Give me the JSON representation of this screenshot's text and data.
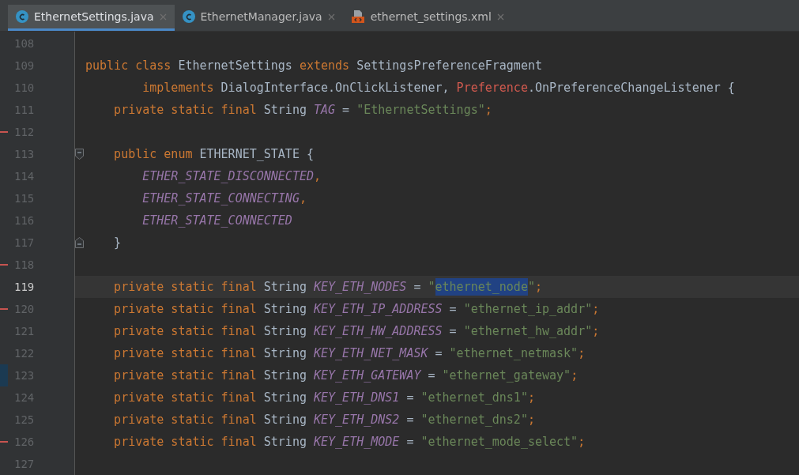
{
  "tabs": [
    {
      "label": "EthernetSettings.java",
      "kind": "class",
      "selected": true
    },
    {
      "label": "EthernetManager.java",
      "kind": "class",
      "selected": false
    },
    {
      "label": "ethernet_settings.xml",
      "kind": "xml",
      "selected": false
    }
  ],
  "lines": [
    {
      "number": "108",
      "kind": "code",
      "current": false
    },
    {
      "number": "109",
      "kind": "code",
      "current": false,
      "tokens": [
        {
          "kind": "kw",
          "text": "public class "
        },
        {
          "kind": "plain",
          "text": "EthernetSettings "
        },
        {
          "kind": "kw",
          "text": "extends "
        },
        {
          "kind": "plain",
          "text": "SettingsPreferenceFragment"
        }
      ]
    },
    {
      "number": "110",
      "kind": "code",
      "current": false,
      "tokens": [
        {
          "kind": "kw",
          "text": "        implements "
        },
        {
          "kind": "plain",
          "text": "DialogInterface.OnClickListener, "
        },
        {
          "kind": "error",
          "text": "Preference"
        },
        {
          "kind": "plain",
          "text": ".OnPreferenceChangeListener {"
        }
      ]
    },
    {
      "number": "111",
      "kind": "code",
      "current": false,
      "tokens": [
        {
          "kind": "kw",
          "text": "    private static final "
        },
        {
          "kind": "plain",
          "text": "String "
        },
        {
          "kind": "field",
          "text": "TAG"
        },
        {
          "kind": "plain",
          "text": " = "
        },
        {
          "kind": "str",
          "text": "\"EthernetSettings\""
        },
        {
          "kind": "kw",
          "text": ";"
        }
      ]
    },
    {
      "number": "112",
      "kind": "code",
      "current": false,
      "color": "#c75450"
    },
    {
      "number": "113",
      "kind": "fold_start",
      "current": false,
      "tokens": [
        {
          "kind": "kw",
          "text": "    public enum "
        },
        {
          "kind": "plain",
          "text": "ETHERNET_STATE {"
        }
      ]
    },
    {
      "number": "114",
      "kind": "code",
      "current": false,
      "tokens": [
        {
          "kind": "field",
          "text": "        ETHER_STATE_DISCONNECTED"
        },
        {
          "kind": "kw",
          "text": ","
        }
      ]
    },
    {
      "number": "115",
      "kind": "code",
      "current": false,
      "tokens": [
        {
          "kind": "field",
          "text": "        ETHER_STATE_CONNECTING"
        },
        {
          "kind": "kw",
          "text": ","
        }
      ]
    },
    {
      "number": "116",
      "kind": "code",
      "current": false,
      "tokens": [
        {
          "kind": "field",
          "text": "        ETHER_STATE_CONNECTED"
        }
      ]
    },
    {
      "number": "117",
      "kind": "fold_end",
      "current": false,
      "tokens": [
        {
          "kind": "plain",
          "text": "    }"
        }
      ]
    },
    {
      "number": "118",
      "kind": "code",
      "current": false,
      "color": "#c75450"
    },
    {
      "number": "119",
      "kind": "code",
      "current": true,
      "tokens": [
        {
          "kind": "kw",
          "text": "    private static final "
        },
        {
          "kind": "plain",
          "text": "String "
        },
        {
          "kind": "field",
          "text": "KEY_ETH_NODES"
        },
        {
          "kind": "plain",
          "text": " = "
        },
        {
          "kind": "str",
          "text": "\""
        },
        {
          "kind": "selection",
          "text": "ethernet_node"
        },
        {
          "kind": "str",
          "text": "\""
        },
        {
          "kind": "kw",
          "text": ";"
        }
      ]
    },
    {
      "number": "120",
      "kind": "code",
      "current": false,
      "color": "#c75450",
      "tokens": [
        {
          "kind": "kw",
          "text": "    private static final "
        },
        {
          "kind": "plain",
          "text": "String "
        },
        {
          "kind": "field",
          "text": "KEY_ETH_IP_ADDRESS"
        },
        {
          "kind": "plain",
          "text": " = "
        },
        {
          "kind": "str",
          "text": "\"ethernet_ip_addr\""
        },
        {
          "kind": "kw",
          "text": ";"
        }
      ]
    },
    {
      "number": "121",
      "kind": "code",
      "current": false,
      "tokens": [
        {
          "kind": "kw",
          "text": "    private static final "
        },
        {
          "kind": "plain",
          "text": "String "
        },
        {
          "kind": "field",
          "text": "KEY_ETH_HW_ADDRESS"
        },
        {
          "kind": "plain",
          "text": " = "
        },
        {
          "kind": "str",
          "text": "\"ethernet_hw_addr\""
        },
        {
          "kind": "kw",
          "text": ";"
        }
      ]
    },
    {
      "number": "122",
      "kind": "code",
      "current": false,
      "tokens": [
        {
          "kind": "kw",
          "text": "    private static final "
        },
        {
          "kind": "plain",
          "text": "String "
        },
        {
          "kind": "field",
          "text": "KEY_ETH_NET_MASK"
        },
        {
          "kind": "plain",
          "text": " = "
        },
        {
          "kind": "str",
          "text": "\"ethernet_netmask\""
        },
        {
          "kind": "kw",
          "text": ";"
        }
      ]
    },
    {
      "number": "123",
      "kind": "code",
      "current": false,
      "color": "#1b3a52",
      "tokens": [
        {
          "kind": "kw",
          "text": "    private static final "
        },
        {
          "kind": "plain",
          "text": "String "
        },
        {
          "kind": "field",
          "text": "KEY_ETH_GATEWAY"
        },
        {
          "kind": "plain",
          "text": " = "
        },
        {
          "kind": "str",
          "text": "\"ethernet_gateway\""
        },
        {
          "kind": "kw",
          "text": ";"
        }
      ]
    },
    {
      "number": "124",
      "kind": "code",
      "current": false,
      "tokens": [
        {
          "kind": "kw",
          "text": "    private static final "
        },
        {
          "kind": "plain",
          "text": "String "
        },
        {
          "kind": "field",
          "text": "KEY_ETH_DNS1"
        },
        {
          "kind": "plain",
          "text": " = "
        },
        {
          "kind": "str",
          "text": "\"ethernet_dns1\""
        },
        {
          "kind": "kw",
          "text": ";"
        }
      ]
    },
    {
      "number": "125",
      "kind": "code",
      "current": false,
      "tokens": [
        {
          "kind": "kw",
          "text": "    private static final "
        },
        {
          "kind": "plain",
          "text": "String "
        },
        {
          "kind": "field",
          "text": "KEY_ETH_DNS2"
        },
        {
          "kind": "plain",
          "text": " = "
        },
        {
          "kind": "str",
          "text": "\"ethernet_dns2\""
        },
        {
          "kind": "kw",
          "text": ";"
        }
      ]
    },
    {
      "number": "126",
      "kind": "code",
      "current": false,
      "color": "#c75450",
      "tokens": [
        {
          "kind": "kw",
          "text": "    private static final "
        },
        {
          "kind": "plain",
          "text": "String "
        },
        {
          "kind": "field",
          "text": "KEY_ETH_MODE"
        },
        {
          "kind": "plain",
          "text": " = "
        },
        {
          "kind": "str",
          "text": "\"ethernet_mode_select\""
        },
        {
          "kind": "kw",
          "text": ";"
        }
      ]
    },
    {
      "number": "127",
      "kind": "code",
      "current": false
    }
  ]
}
